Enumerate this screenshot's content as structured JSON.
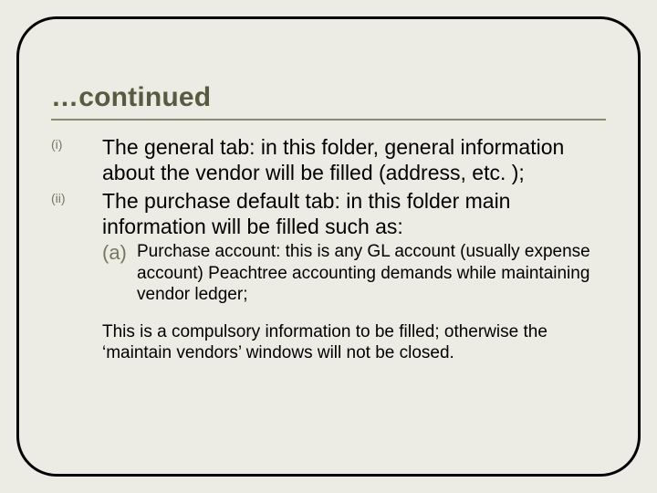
{
  "title": "…continued",
  "items": [
    {
      "marker": "(i)",
      "text": "The general tab:  in this folder, general information about the vendor will be filled (address, etc. );"
    },
    {
      "marker": "(ii)",
      "text": "The purchase default tab:  in this folder main information will be filled such as:",
      "sub": {
        "marker": "(a)",
        "text": "Purchase account:  this is any GL account (usually expense account) Peachtree accounting demands while maintaining vendor ledger;"
      }
    }
  ],
  "note": "This is a compulsory information to be filled; otherwise the ‘maintain vendors’ windows will not be closed."
}
